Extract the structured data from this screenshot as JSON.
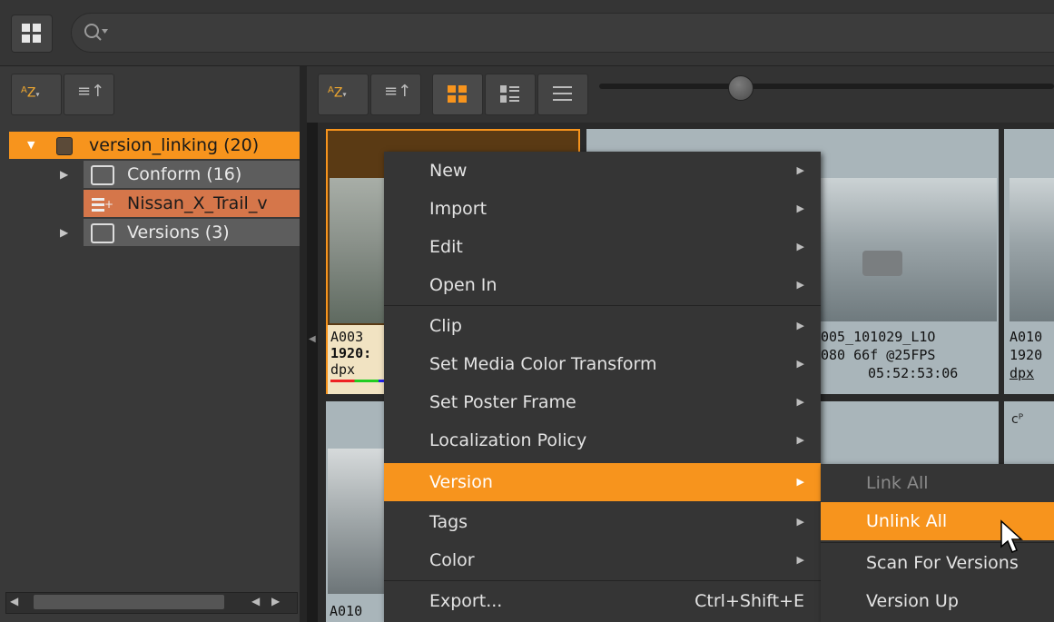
{
  "tree": {
    "root_label": "version_linking (20)",
    "items": [
      {
        "label": "Conform (16)"
      },
      {
        "label": "Nissan_X_Trail_v"
      },
      {
        "label": "Versions (3)"
      }
    ]
  },
  "toolbar": {
    "sort_az_label": "A Z"
  },
  "tiles": {
    "t1": {
      "line1": "A003",
      "line2": "1920:",
      "line3": "dpx"
    },
    "t2": {
      "line1": "005_101029_L1O",
      "line2": "080  66f @25FPS",
      "line3": "05:52:53:06"
    },
    "t3": {
      "line1": "A010",
      "line2": "1920",
      "line3": "dpx"
    },
    "t4": {
      "line1": "A010"
    },
    "t5": {
      "glyph": "cᴾ"
    }
  },
  "menu": {
    "items": [
      {
        "label": "New"
      },
      {
        "label": "Import"
      },
      {
        "label": "Edit"
      },
      {
        "label": "Open In"
      },
      {
        "label": "Clip"
      },
      {
        "label": "Set Media Color Transform"
      },
      {
        "label": "Set Poster Frame"
      },
      {
        "label": "Localization Policy"
      },
      {
        "label": "Version"
      },
      {
        "label": "Tags"
      },
      {
        "label": "Color"
      },
      {
        "label": "Export...",
        "shortcut": "Ctrl+Shift+E"
      }
    ]
  },
  "submenu": {
    "items": [
      {
        "label": "Link All"
      },
      {
        "label": "Unlink All"
      },
      {
        "label": "Scan For Versions"
      },
      {
        "label": "Version Up"
      }
    ]
  },
  "colors": {
    "accent": "#f7941d",
    "panel": "#393939",
    "menu": "#353535"
  },
  "icons": [
    "grid-icon",
    "search-icon",
    "sort-az-icon",
    "sort-order-icon",
    "thumbnail-view-icon",
    "list-detail-view-icon",
    "list-view-icon",
    "folder-icon",
    "sequence-icon",
    "project-icon",
    "submenu-arrow-icon",
    "mouse-cursor-icon"
  ]
}
